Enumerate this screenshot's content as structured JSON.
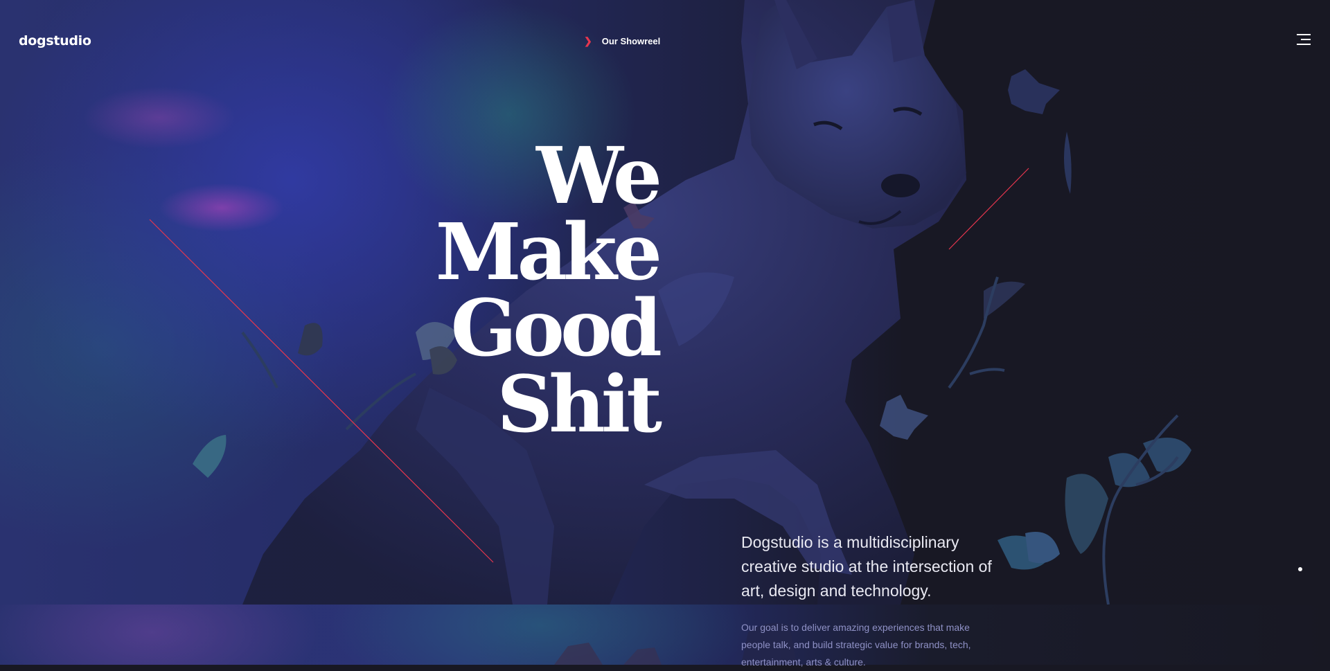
{
  "header": {
    "logo": "dogstudio",
    "showreel_label": "Our Showreel",
    "menu_icon": "hamburger-menu-icon",
    "showreel_icon": "chevron-right-icon"
  },
  "hero": {
    "headline_lines": [
      "We",
      "Make",
      "Good",
      "Shit"
    ],
    "image": "wolf-sculpture-with-leaves"
  },
  "intro": {
    "lead": "Dogstudio is a multidisciplinary creative studio at the intersection of art, design and technology.",
    "goal": "Our goal is to deliver amazing experiences that make people talk, and build strategic value for brands, tech, entertainment, arts & culture."
  },
  "colors": {
    "accent": "#e8364e",
    "background": "#181823",
    "text": "#ffffff",
    "muted_text": "#8f91c6"
  }
}
